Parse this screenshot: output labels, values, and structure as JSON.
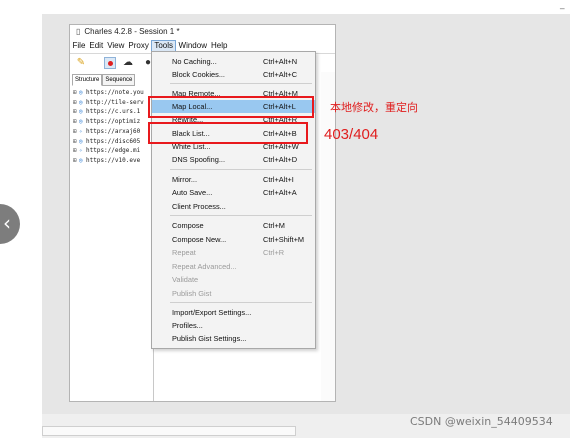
{
  "window": {
    "title": "Charles 4.2.8 - Session 1 *",
    "menus": [
      "File",
      "Edit",
      "View",
      "Proxy",
      "Tools",
      "Window",
      "Help"
    ],
    "open_menu": "Tools"
  },
  "toolbar": {
    "icons": [
      "broom-icon",
      "record-icon",
      "throttle-icon",
      "more-icon"
    ]
  },
  "left_pane": {
    "tabs": [
      "Structure",
      "Sequence"
    ],
    "tree": [
      "https://note.you",
      "http://tile-serv",
      "https://c.urs.1",
      "https://optimiz",
      "https://arxaj60",
      "https://disc605",
      "https://edge.mi",
      "https://v10.eve"
    ]
  },
  "tools_menu": {
    "items": [
      {
        "label": "No Caching...",
        "shortcut": "Ctrl+Alt+N"
      },
      {
        "label": "Block Cookies...",
        "shortcut": "Ctrl+Alt+C"
      },
      {
        "label": "Map Remote...",
        "shortcut": "Ctrl+Alt+M"
      },
      {
        "label": "Map Local...",
        "shortcut": "Ctrl+Alt+L"
      },
      {
        "label": "Rewrite...",
        "shortcut": "Ctrl+Alt+R"
      },
      {
        "label": "Black List...",
        "shortcut": "Ctrl+Alt+B"
      },
      {
        "label": "White List...",
        "shortcut": "Ctrl+Alt+W"
      },
      {
        "label": "DNS Spoofing...",
        "shortcut": "Ctrl+Alt+D"
      },
      {
        "label": "Mirror...",
        "shortcut": "Ctrl+Alt+I"
      },
      {
        "label": "Auto Save...",
        "shortcut": "Ctrl+Alt+A"
      },
      {
        "label": "Client Process...",
        "shortcut": ""
      },
      {
        "label": "Compose",
        "shortcut": "Ctrl+M"
      },
      {
        "label": "Compose New...",
        "shortcut": "Ctrl+Shift+M"
      },
      {
        "label": "Repeat",
        "shortcut": "Ctrl+R"
      },
      {
        "label": "Repeat Advanced...",
        "shortcut": ""
      },
      {
        "label": "Validate",
        "shortcut": ""
      },
      {
        "label": "Publish Gist",
        "shortcut": ""
      },
      {
        "label": "Import/Export Settings...",
        "shortcut": ""
      },
      {
        "label": "Profiles...",
        "shortcut": ""
      },
      {
        "label": "Publish Gist Settings...",
        "shortcut": ""
      }
    ]
  },
  "annotations": {
    "map_local_note": "本地修改，重定向",
    "black_list_note": "403/404"
  },
  "watermark": "CSDN @weixin_54409534",
  "colors": {
    "highlight": "#99c8f0",
    "annotation_red": "#e8191d"
  }
}
